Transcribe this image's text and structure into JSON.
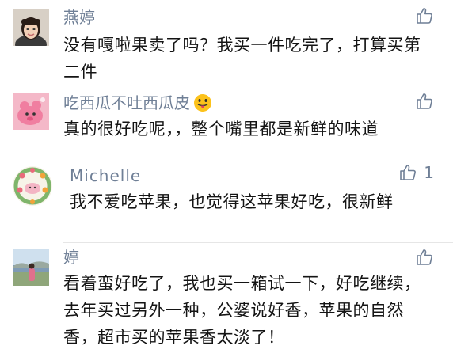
{
  "comments": [
    {
      "author": "燕婷",
      "text": "没有嘎啦果卖了吗？我买一件吃完了，打算买第二件",
      "likes": "",
      "avatar_icon": "woman-portrait-avatar"
    },
    {
      "author": "吃西瓜不吐西瓜皮",
      "text": "真的很好吃呢，，整个嘴里都是新鲜的味道",
      "likes": "",
      "avatar_icon": "pink-cartoon-avatar",
      "emoji": "tongue-out-emoji"
    },
    {
      "author": "Michelle",
      "text": "我不爱吃苹果，也觉得这苹果好吃，很新鲜",
      "likes": "1",
      "avatar_icon": "flower-wreath-avatar"
    },
    {
      "author": "婷",
      "text": "看着蛮好吃了，我也买一箱试一下，好吃继续，去年买过另外一种，公婆说好香，苹果的自然香，超市买的苹果香太淡了！",
      "likes": "",
      "avatar_icon": "seaside-landscape-avatar"
    }
  ],
  "colors": {
    "name": "#6f7f96",
    "text": "#141414",
    "divider": "#e6e6e6"
  }
}
